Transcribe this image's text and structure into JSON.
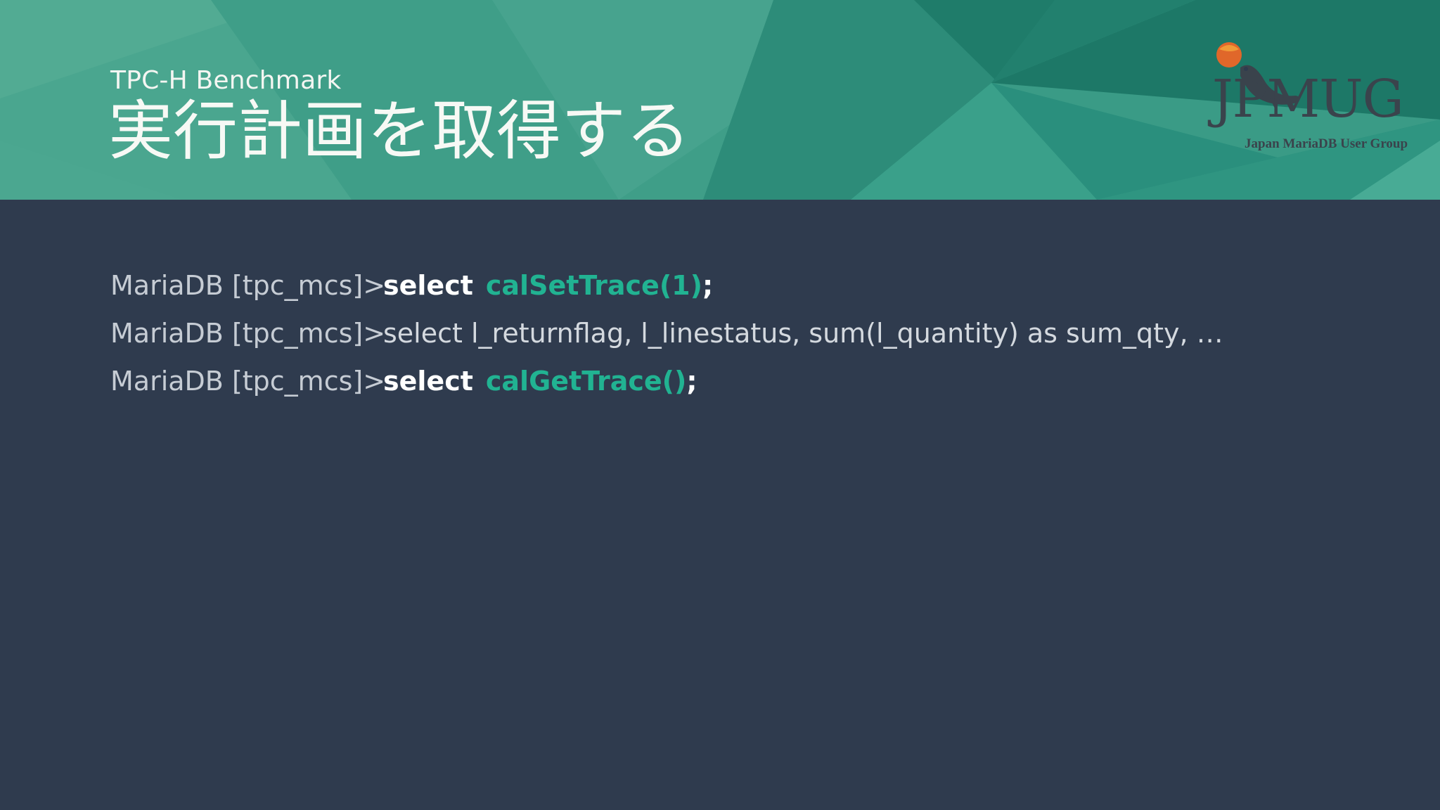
{
  "slide": {
    "subtitle": "TPC-H Benchmark",
    "title": "実行計画を取得する"
  },
  "logo": {
    "wordmark": "JPMUG",
    "tagline": "Japan MariaDB User Group"
  },
  "console": {
    "lines": [
      {
        "prompt": "MariaDB  [tpc_mcs]>",
        "keyword": "select",
        "function": "calSetTrace(1)",
        "terminator": ";"
      },
      {
        "prompt": "MariaDB  [tpc_mcs]>",
        "text": "select l_returnflag, l_linestatus, sum(l_quantity) as sum_qty, …"
      },
      {
        "prompt": "MariaDB  [tpc_mcs]>",
        "keyword": "select",
        "function": "calGetTrace()",
        "terminator": ";"
      }
    ]
  },
  "colors": {
    "background": "#2f3b4e",
    "header_teal": "#2a8f7d",
    "accent_green": "#21b392",
    "prompt_gray": "#c6ccd4"
  }
}
